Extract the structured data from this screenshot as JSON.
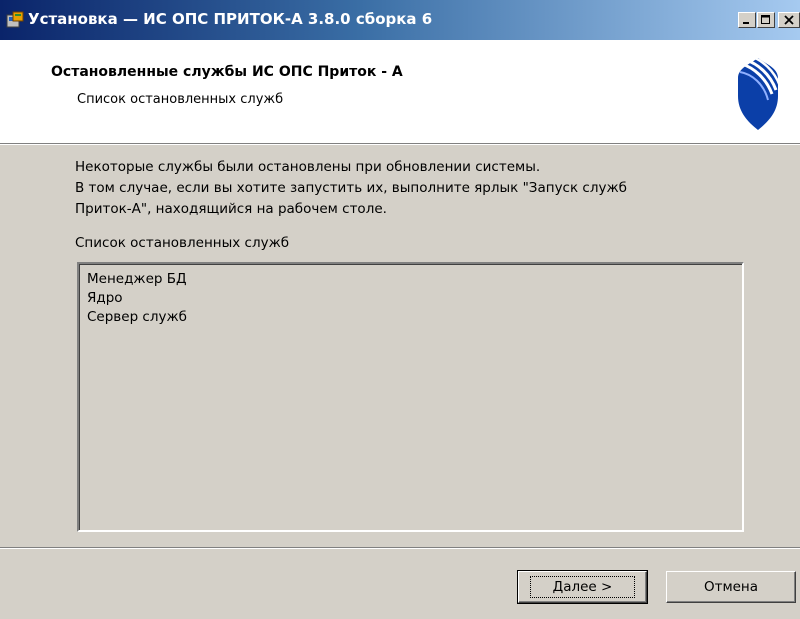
{
  "window": {
    "title": "Установка — ИС ОПС ПРИТОК-А 3.8.0 сборка 6",
    "icons": [
      "installer-icon",
      "minimize-icon",
      "maximize-icon",
      "close-icon"
    ]
  },
  "header": {
    "title": "Остановленные службы ИС ОПС Приток - А",
    "subtitle": "Список остановленных служб"
  },
  "body": {
    "lines": [
      "Некоторые службы были остановлены при обновлении системы.",
      "В том случае, если вы хотите запустить их, выполните ярлык \"Запуск служб",
      "Приток-А\", находящийся на рабочем столе."
    ],
    "list_label": "Список остановленных служб",
    "services": [
      "Менеджер БД",
      "Ядро",
      "Сервер служб"
    ]
  },
  "buttons": {
    "next_label": "Далее >",
    "cancel_label": "Отмена"
  },
  "colors": {
    "titlebar_start": "#0a246a",
    "dialog_bg": "#d4d0c8",
    "logo_blue": "#0b3fa8"
  }
}
